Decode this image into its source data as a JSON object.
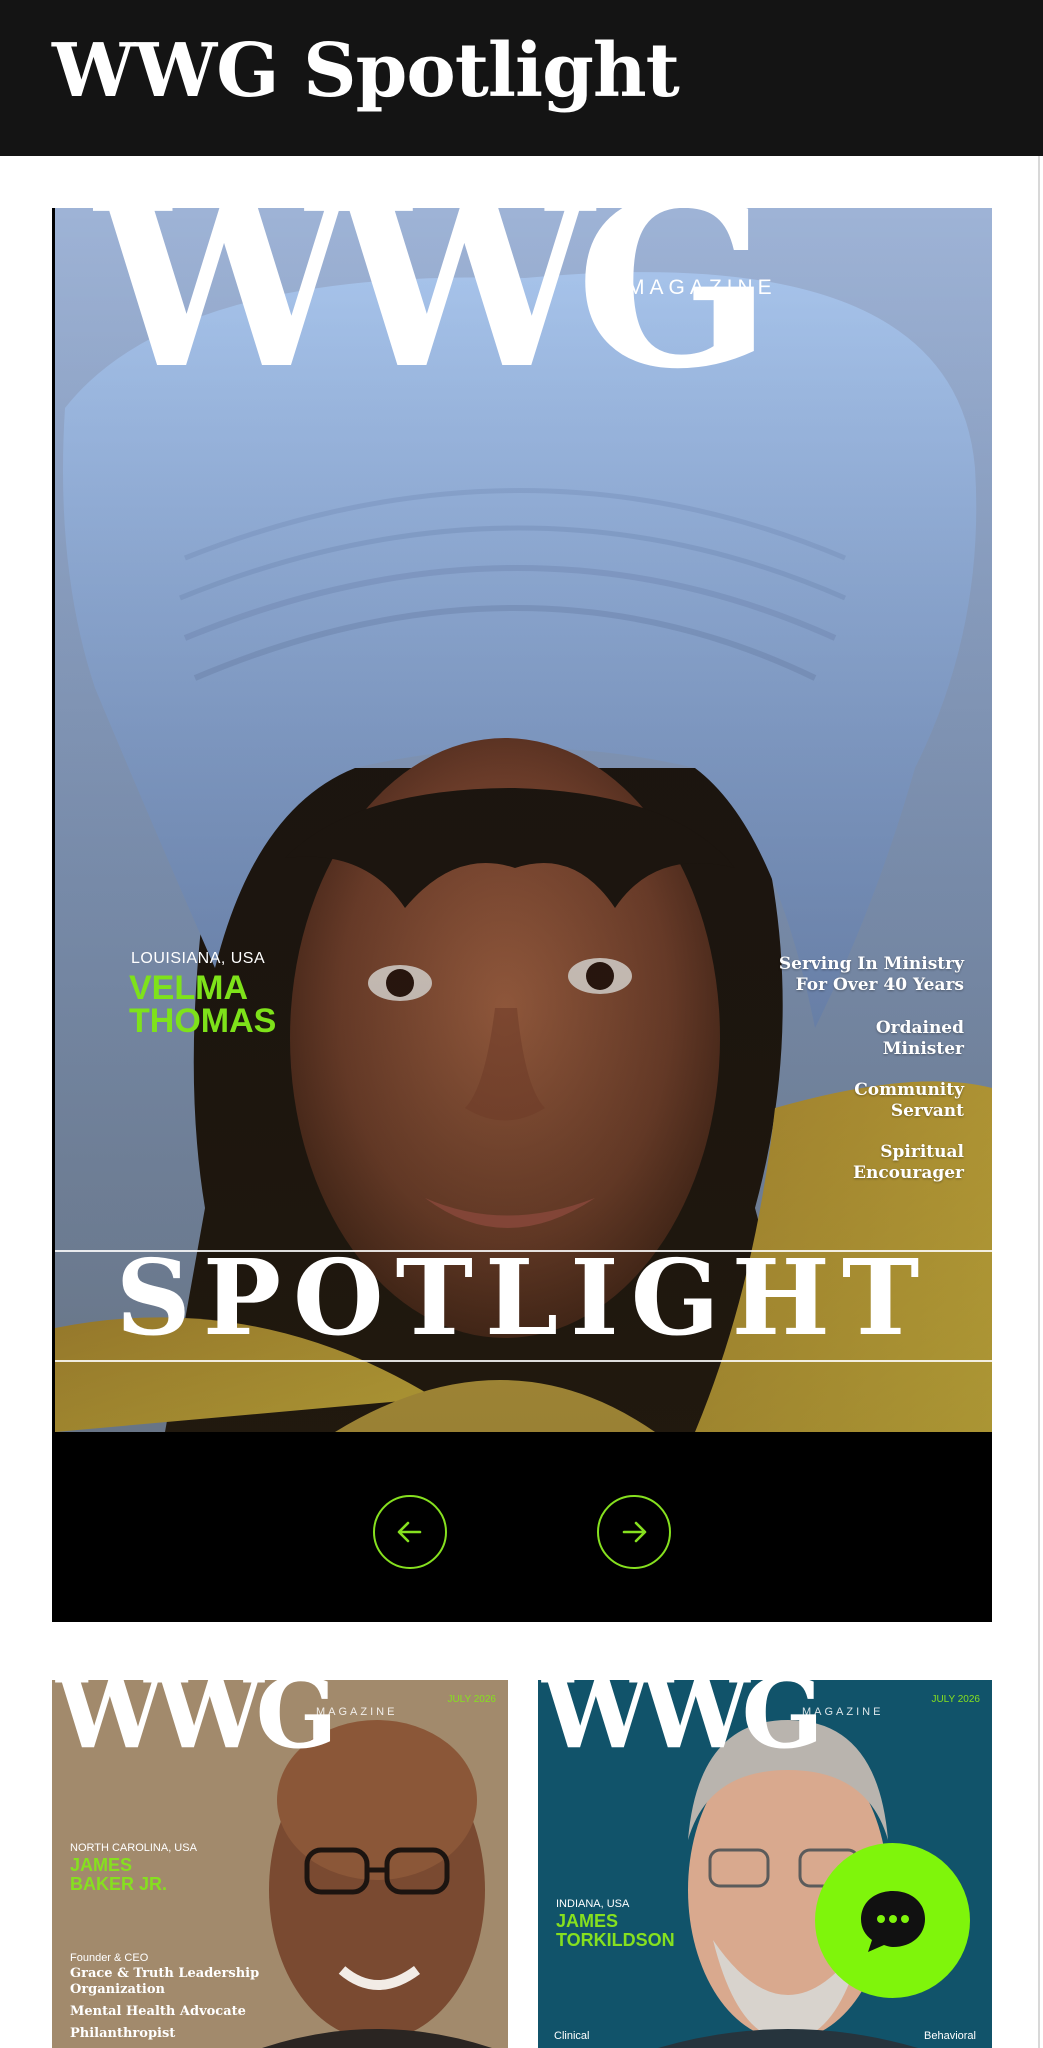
{
  "header": {
    "title": "WWG Spotlight"
  },
  "hero": {
    "brand": "WWG",
    "magazine_word": "MAGAZINE",
    "location": "LOUISIANA, USA",
    "name_line1": "VELMA",
    "name_line2": "THOMAS",
    "taglines": [
      {
        "line1": "Serving In Ministry",
        "line2": "For Over 40 Years"
      },
      {
        "line1": "Ordained",
        "line2": "Minister"
      },
      {
        "line1": "Community",
        "line2": "Servant"
      },
      {
        "line1": "Spiritual",
        "line2": "Encourager"
      }
    ],
    "banner": "SPOTLIGHT"
  },
  "carousel": {
    "prev_icon": "arrow-left-icon",
    "next_icon": "arrow-right-icon"
  },
  "covers": [
    {
      "brand": "WWG",
      "magazine_word": "MAGAZINE",
      "issue": "JULY 2026",
      "location": "NORTH CAROLINA, USA",
      "name_line1": "JAMES",
      "name_line2": "BAKER JR.",
      "role": "Founder & CEO",
      "line1": "Grace & Truth Leadership",
      "line2": "Organization",
      "line3": "Mental Health Advocate",
      "line4": "Philanthropist"
    },
    {
      "brand": "WWG",
      "magazine_word": "MAGAZINE",
      "issue": "JULY 2026",
      "location": "INDIANA, USA",
      "name_line1": "JAMES",
      "name_line2": "TORKILDSON",
      "left_caption": "Clinical",
      "right_caption": "Behavioral"
    }
  ],
  "chat": {
    "icon": "chat-bubble-icon"
  },
  "colors": {
    "accent": "#7ff50b",
    "name_green": "#7ee21a",
    "topbar": "#141414"
  }
}
